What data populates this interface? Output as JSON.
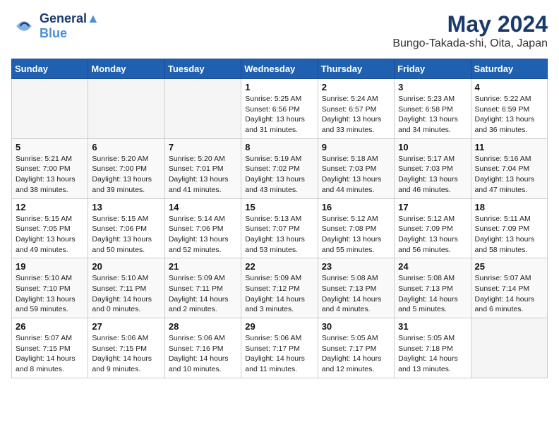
{
  "header": {
    "logo_line1": "General",
    "logo_line2": "Blue",
    "month": "May 2024",
    "location": "Bungo-Takada-shi, Oita, Japan"
  },
  "weekdays": [
    "Sunday",
    "Monday",
    "Tuesday",
    "Wednesday",
    "Thursday",
    "Friday",
    "Saturday"
  ],
  "weeks": [
    [
      {
        "day": "",
        "info": ""
      },
      {
        "day": "",
        "info": ""
      },
      {
        "day": "",
        "info": ""
      },
      {
        "day": "1",
        "info": "Sunrise: 5:25 AM\nSunset: 6:56 PM\nDaylight: 13 hours\nand 31 minutes."
      },
      {
        "day": "2",
        "info": "Sunrise: 5:24 AM\nSunset: 6:57 PM\nDaylight: 13 hours\nand 33 minutes."
      },
      {
        "day": "3",
        "info": "Sunrise: 5:23 AM\nSunset: 6:58 PM\nDaylight: 13 hours\nand 34 minutes."
      },
      {
        "day": "4",
        "info": "Sunrise: 5:22 AM\nSunset: 6:59 PM\nDaylight: 13 hours\nand 36 minutes."
      }
    ],
    [
      {
        "day": "5",
        "info": "Sunrise: 5:21 AM\nSunset: 7:00 PM\nDaylight: 13 hours\nand 38 minutes."
      },
      {
        "day": "6",
        "info": "Sunrise: 5:20 AM\nSunset: 7:00 PM\nDaylight: 13 hours\nand 39 minutes."
      },
      {
        "day": "7",
        "info": "Sunrise: 5:20 AM\nSunset: 7:01 PM\nDaylight: 13 hours\nand 41 minutes."
      },
      {
        "day": "8",
        "info": "Sunrise: 5:19 AM\nSunset: 7:02 PM\nDaylight: 13 hours\nand 43 minutes."
      },
      {
        "day": "9",
        "info": "Sunrise: 5:18 AM\nSunset: 7:03 PM\nDaylight: 13 hours\nand 44 minutes."
      },
      {
        "day": "10",
        "info": "Sunrise: 5:17 AM\nSunset: 7:03 PM\nDaylight: 13 hours\nand 46 minutes."
      },
      {
        "day": "11",
        "info": "Sunrise: 5:16 AM\nSunset: 7:04 PM\nDaylight: 13 hours\nand 47 minutes."
      }
    ],
    [
      {
        "day": "12",
        "info": "Sunrise: 5:15 AM\nSunset: 7:05 PM\nDaylight: 13 hours\nand 49 minutes."
      },
      {
        "day": "13",
        "info": "Sunrise: 5:15 AM\nSunset: 7:06 PM\nDaylight: 13 hours\nand 50 minutes."
      },
      {
        "day": "14",
        "info": "Sunrise: 5:14 AM\nSunset: 7:06 PM\nDaylight: 13 hours\nand 52 minutes."
      },
      {
        "day": "15",
        "info": "Sunrise: 5:13 AM\nSunset: 7:07 PM\nDaylight: 13 hours\nand 53 minutes."
      },
      {
        "day": "16",
        "info": "Sunrise: 5:12 AM\nSunset: 7:08 PM\nDaylight: 13 hours\nand 55 minutes."
      },
      {
        "day": "17",
        "info": "Sunrise: 5:12 AM\nSunset: 7:09 PM\nDaylight: 13 hours\nand 56 minutes."
      },
      {
        "day": "18",
        "info": "Sunrise: 5:11 AM\nSunset: 7:09 PM\nDaylight: 13 hours\nand 58 minutes."
      }
    ],
    [
      {
        "day": "19",
        "info": "Sunrise: 5:10 AM\nSunset: 7:10 PM\nDaylight: 13 hours\nand 59 minutes."
      },
      {
        "day": "20",
        "info": "Sunrise: 5:10 AM\nSunset: 7:11 PM\nDaylight: 14 hours\nand 0 minutes."
      },
      {
        "day": "21",
        "info": "Sunrise: 5:09 AM\nSunset: 7:11 PM\nDaylight: 14 hours\nand 2 minutes."
      },
      {
        "day": "22",
        "info": "Sunrise: 5:09 AM\nSunset: 7:12 PM\nDaylight: 14 hours\nand 3 minutes."
      },
      {
        "day": "23",
        "info": "Sunrise: 5:08 AM\nSunset: 7:13 PM\nDaylight: 14 hours\nand 4 minutes."
      },
      {
        "day": "24",
        "info": "Sunrise: 5:08 AM\nSunset: 7:13 PM\nDaylight: 14 hours\nand 5 minutes."
      },
      {
        "day": "25",
        "info": "Sunrise: 5:07 AM\nSunset: 7:14 PM\nDaylight: 14 hours\nand 6 minutes."
      }
    ],
    [
      {
        "day": "26",
        "info": "Sunrise: 5:07 AM\nSunset: 7:15 PM\nDaylight: 14 hours\nand 8 minutes."
      },
      {
        "day": "27",
        "info": "Sunrise: 5:06 AM\nSunset: 7:15 PM\nDaylight: 14 hours\nand 9 minutes."
      },
      {
        "day": "28",
        "info": "Sunrise: 5:06 AM\nSunset: 7:16 PM\nDaylight: 14 hours\nand 10 minutes."
      },
      {
        "day": "29",
        "info": "Sunrise: 5:06 AM\nSunset: 7:17 PM\nDaylight: 14 hours\nand 11 minutes."
      },
      {
        "day": "30",
        "info": "Sunrise: 5:05 AM\nSunset: 7:17 PM\nDaylight: 14 hours\nand 12 minutes."
      },
      {
        "day": "31",
        "info": "Sunrise: 5:05 AM\nSunset: 7:18 PM\nDaylight: 14 hours\nand 13 minutes."
      },
      {
        "day": "",
        "info": ""
      }
    ]
  ]
}
